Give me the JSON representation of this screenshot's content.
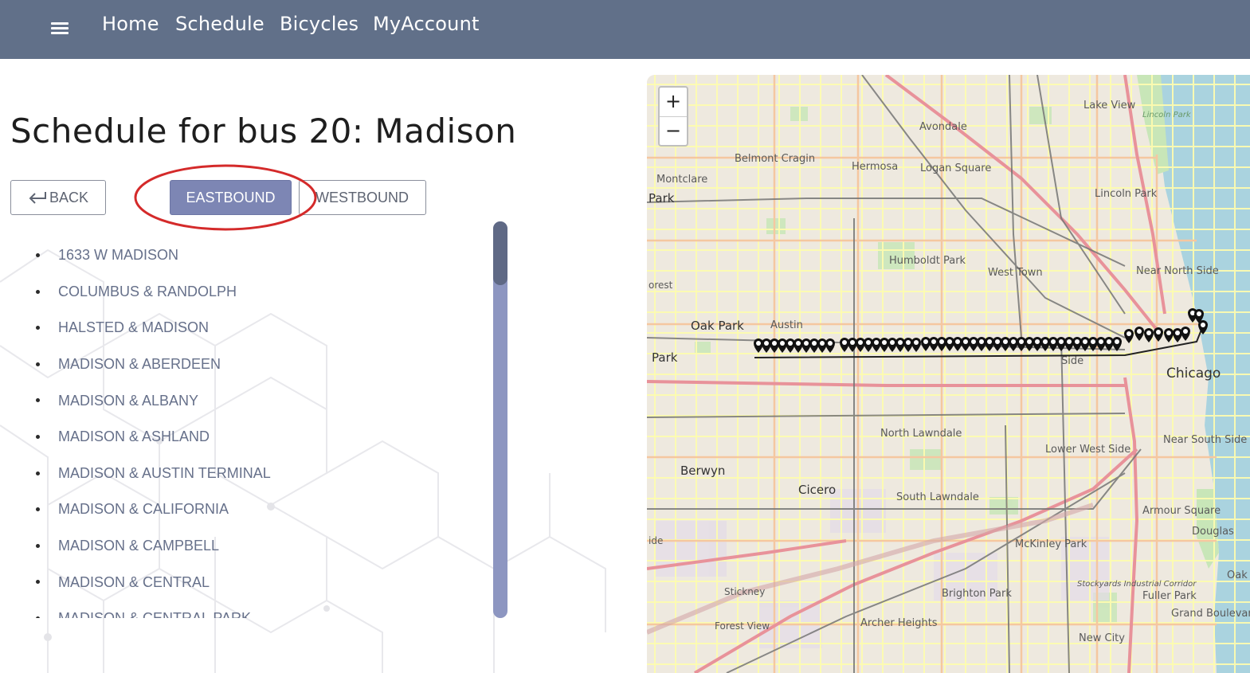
{
  "nav": {
    "menu_icon": "hamburger-menu-icon",
    "links": [
      "Home",
      "Schedule",
      "Bicycles",
      "MyAccount"
    ]
  },
  "page": {
    "title": "Schedule for bus 20: Madison"
  },
  "buttons": {
    "back_label": "BACK",
    "back_icon": "return-arrow-icon",
    "eastbound_label": "EASTBOUND",
    "westbound_label": "WESTBOUND",
    "active_direction": "EASTBOUND"
  },
  "stops": [
    "1633 W MADISON",
    "COLUMBUS & RANDOLPH",
    "HALSTED & MADISON",
    "MADISON & ABERDEEN",
    "MADISON & ALBANY",
    "MADISON & ASHLAND",
    "MADISON & AUSTIN TERMINAL",
    "MADISON & CALIFORNIA",
    "MADISON & CAMPBELL",
    "MADISON & CENTRAL",
    "MADISON & CENTRAL PARK"
  ],
  "map": {
    "zoom_in": "+",
    "zoom_out": "−",
    "labels": {
      "chicago": "Chicago",
      "oak_park": "Oak Park",
      "austin": "Austin",
      "berwyn": "Berwyn",
      "cicero": "Cicero",
      "humboldt_park": "Humboldt Park",
      "west_town": "West Town",
      "lincoln_park": "Lincoln Park",
      "lake_view": "Lake View",
      "avondale": "Avondale",
      "logan_square": "Logan Square",
      "hermosa": "Hermosa",
      "belmont_cragin": "Belmont Cragin",
      "montclare": "Montclare",
      "near_north_side": "Near North Side",
      "north_lawndale": "North Lawndale",
      "south_lawndale": "South Lawndale",
      "lower_west_side": "Lower West Side",
      "near_south_side": "Near South Side",
      "armour_square": "Armour Square",
      "douglas": "Douglas",
      "mckinley_park": "McKinley Park",
      "brighton_park": "Brighton Park",
      "archer_heights": "Archer Heights",
      "stickney": "Stickney",
      "forest_view": "Forest View",
      "new_city": "New City",
      "fuller_park": "Fuller Park",
      "grand_boulevard": "Grand Boulevard",
      "stockyards": "Stockyards Industrial Corridor",
      "lincoln_park_green": "Lincoln Park",
      "park_left": "Park",
      "park_left2": "Park",
      "forest": "orest",
      "ide": "ide",
      "oak": "Oak",
      "side": "Side"
    },
    "marker_color": "#111111",
    "route_color": "#222222"
  }
}
